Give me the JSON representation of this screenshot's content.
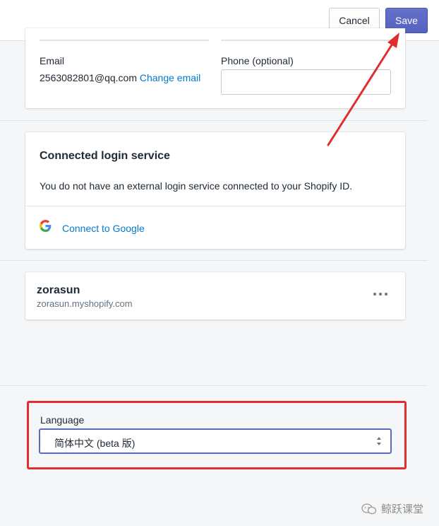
{
  "header": {
    "cancel_label": "Cancel",
    "save_label": "Save"
  },
  "account": {
    "email_label": "Email",
    "email_value": "2563082801@qq.com",
    "change_email_link": "Change email",
    "phone_label": "Phone (optional)",
    "phone_value": ""
  },
  "login_service": {
    "title": "Connected login service",
    "description": "You do not have an external login service connected to your Shopify ID.",
    "connect_google_label": "Connect to Google"
  },
  "store": {
    "name": "zorasun",
    "domain": "zorasun.myshopify.com"
  },
  "language": {
    "label": "Language",
    "selected": "简体中文 (beta 版)"
  },
  "watermark": {
    "text": "鲸跃课堂"
  },
  "colors": {
    "accent": "#5c6ac4",
    "link": "#007ace",
    "annotation_red": "#e02d2d"
  }
}
